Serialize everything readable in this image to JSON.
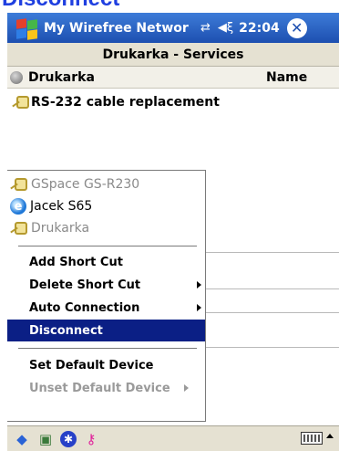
{
  "caption": "Disconnect",
  "titlebar": {
    "title": "My Wirefree Networ",
    "time": "22:04",
    "connectivity_icon": "⇄",
    "volume_icon": "◀ξ",
    "close_label": "✕"
  },
  "subheader": {
    "title": "Drukarka - Services"
  },
  "columns": {
    "device": "Drukarka",
    "name": "Name"
  },
  "services": [
    {
      "label": "RS-232 cable replacement"
    }
  ],
  "menu": {
    "devices": [
      {
        "label": "GSpace GS-R230",
        "icon": "plug-icon"
      },
      {
        "label": "Jacek S65",
        "icon": "ie-icon"
      },
      {
        "label": "Drukarka",
        "icon": "plug-icon"
      }
    ],
    "commands": [
      {
        "label": "Add Short Cut"
      },
      {
        "label": "Delete Short Cut"
      },
      {
        "label": "Auto Connection"
      },
      {
        "label": "Disconnect"
      },
      {
        "label": "Set Default Device"
      },
      {
        "label": "Unset Default Device"
      }
    ]
  },
  "colors": {
    "titlebar": "#1d4fb0",
    "selection": "#0b1f85",
    "caption": "#1f3fe0"
  }
}
